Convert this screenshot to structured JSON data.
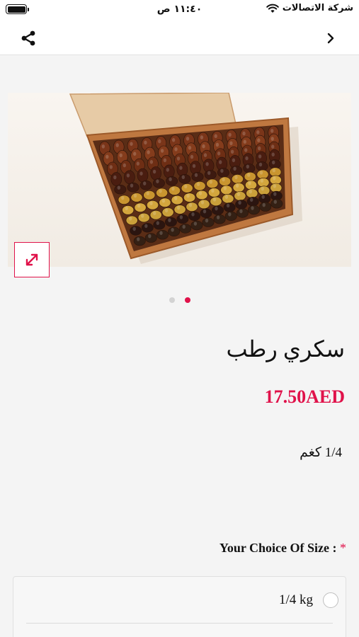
{
  "status_bar": {
    "time": "١١:٤٠ ص",
    "carrier": "شركة الاتصالات"
  },
  "nav": {
    "share_icon": "share-icon",
    "back_icon": "chevron-right-icon"
  },
  "gallery": {
    "image_description": "",
    "expand_icon": "expand-arrows-icon",
    "page_count": 2,
    "active_page": 2
  },
  "product": {
    "title": "سكري رطب",
    "price": "17.50AED",
    "weight": "1/4 كغم"
  },
  "size_choice": {
    "heading": "Your Choice Of Size :",
    "required_mark": "*",
    "options": [
      {
        "label": "1/4 kg",
        "selected": false
      }
    ]
  },
  "colors": {
    "accent": "#e0124a"
  }
}
